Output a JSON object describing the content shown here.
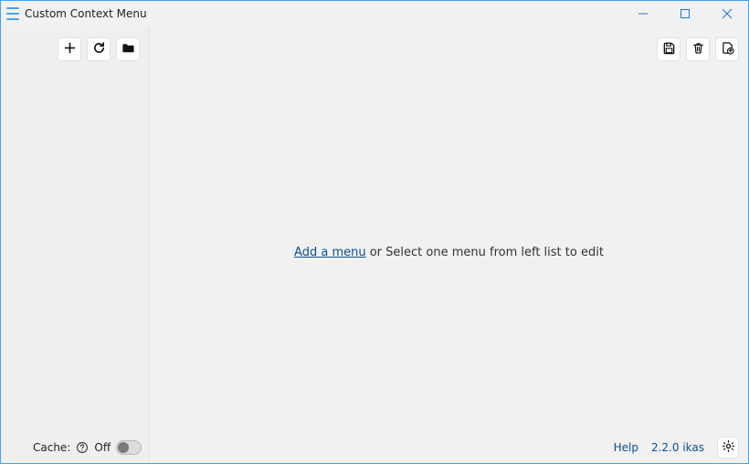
{
  "titlebar": {
    "title": "Custom Context Menu"
  },
  "sidebar": {
    "cache_label": "Cache:",
    "cache_state": "Off"
  },
  "main": {
    "add_link": "Add a menu",
    "hint_rest": " or Select one menu from left list to edit"
  },
  "footer": {
    "help": "Help",
    "version": "2.2.0 ikas"
  }
}
